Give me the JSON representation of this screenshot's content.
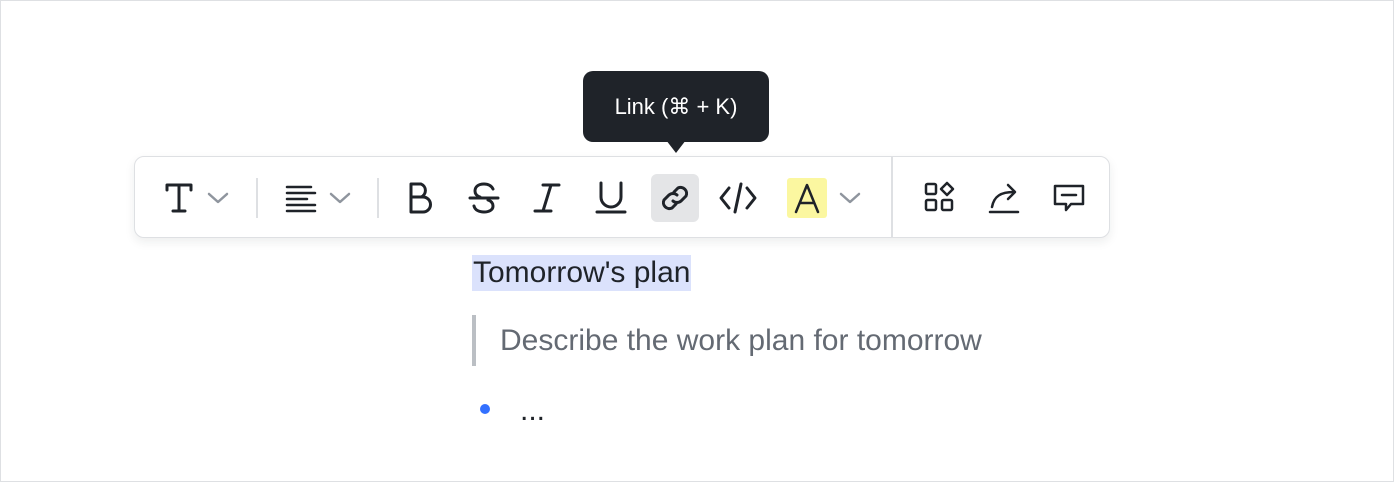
{
  "tooltip": {
    "text": "Link (⌘ + K)"
  },
  "toolbar": {
    "items": [
      {
        "name": "text-style",
        "icon": "text-type-icon",
        "has_dropdown": true
      },
      {
        "name": "align",
        "icon": "align-left-icon",
        "has_dropdown": true
      },
      {
        "name": "bold",
        "icon": "bold-icon",
        "glyph": "B"
      },
      {
        "name": "strikethrough",
        "icon": "strikethrough-icon",
        "glyph": "S"
      },
      {
        "name": "italic",
        "icon": "italic-icon",
        "glyph": "I"
      },
      {
        "name": "underline",
        "icon": "underline-icon",
        "glyph": "U"
      },
      {
        "name": "link",
        "icon": "link-icon",
        "active": true
      },
      {
        "name": "code",
        "icon": "code-icon"
      },
      {
        "name": "highlight",
        "icon": "highlight-icon",
        "glyph": "A",
        "has_dropdown": true
      },
      {
        "name": "more-blocks",
        "icon": "grid-shapes-icon"
      },
      {
        "name": "share",
        "icon": "share-icon"
      },
      {
        "name": "comment",
        "icon": "comment-icon"
      }
    ],
    "colors": {
      "icon": "#1f2329",
      "chevron": "#8f959e",
      "active_bg": "#e4e5e7",
      "highlight_bg": "#fbf7a0"
    }
  },
  "document": {
    "heading": "Tomorrow's plan",
    "quote": "Describe the work plan for tomorrow",
    "bullet": "...",
    "colors": {
      "selection": "#dbe2fc",
      "bullet": "#3370ff",
      "quote_bar": "#bbbfc4"
    }
  }
}
